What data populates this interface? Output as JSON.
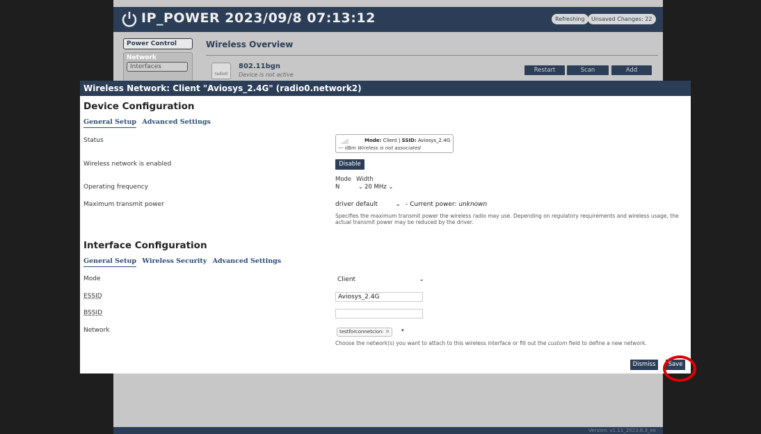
{
  "app": {
    "title": "IP_POWER  2023/09/8 07:13:12",
    "badges": {
      "refreshing": "Refreshing",
      "unsaved": "Unsaved Changes: 22"
    },
    "sidebar": {
      "power_control": "Power Control",
      "network": "Network",
      "interfaces": "Interfaces"
    },
    "main": {
      "title": "Wireless Overview",
      "radio": {
        "icon_label": "radio0",
        "name": "802.11bgn",
        "status": "Device is not active"
      },
      "buttons": {
        "restart": "Restart",
        "scan": "Scan",
        "add": "Add"
      }
    },
    "version": "Version: v1.11_2023.8.3_ee"
  },
  "modal": {
    "title": "Wireless Network: Client \"Aviosys_2.4G\" (radio0.network2)",
    "device_config": {
      "heading": "Device Configuration",
      "tabs": [
        "General Setup",
        "Advanced Settings"
      ],
      "status_label": "Status",
      "status": {
        "mode_label": "Mode:",
        "mode": "Client",
        "ssid_label": "SSID:",
        "ssid": "Aviosys_2.4G",
        "dbm": "--- dBm",
        "assoc": "Wireless is not associated"
      },
      "enabled_label": "Wireless network is enabled",
      "disable_button": "Disable",
      "freq_label": "Operating frequency",
      "freq": {
        "mode_label": "Mode",
        "width_label": "Width",
        "mode": "N",
        "width": "20 MHz"
      },
      "power_label": "Maximum transmit power",
      "power_value": "driver default",
      "power_current_prefix": "- Current power:",
      "power_current": "unknown",
      "power_desc": "Specifies the maximum transmit power the wireless radio may use. Depending on regulatory requirements and wireless usage, the actual transmit power may be reduced by the driver."
    },
    "interface_config": {
      "heading": "Interface Configuration",
      "tabs": [
        "General Setup",
        "Wireless Security",
        "Advanced Settings"
      ],
      "mode_label": "Mode",
      "mode_value": "Client",
      "essid_label": "ESSID",
      "essid_value": "Aviosys_2.4G",
      "bssid_label": "BSSID",
      "bssid_value": "",
      "network_label": "Network",
      "network_value": "testforconnetcion:",
      "network_desc_pre": "Choose the network(s) you want to attach to this wireless interface or fill out the ",
      "network_desc_em": "custom",
      "network_desc_post": " field to define a new network."
    },
    "buttons": {
      "dismiss": "Dismiss",
      "save": "Save"
    }
  },
  "colors": {
    "header": "#2c3e57",
    "highlight": "#e00000",
    "link": "#2c4a7a"
  }
}
